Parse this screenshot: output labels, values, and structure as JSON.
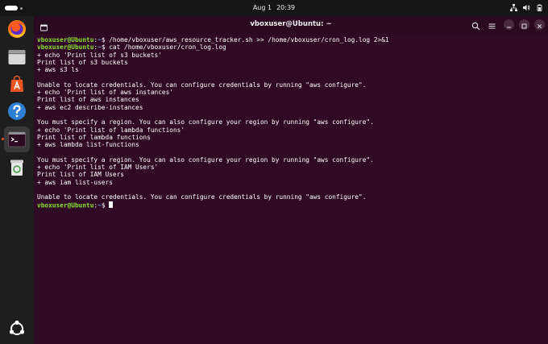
{
  "topbar": {
    "date": "Aug 1",
    "time": "20:39",
    "tray_icons": [
      "network-icon",
      "volume-icon",
      "battery-icon"
    ]
  },
  "dock": {
    "items": [
      {
        "name": "firefox-icon"
      },
      {
        "name": "files-icon"
      },
      {
        "name": "app-center-icon"
      },
      {
        "name": "help-icon"
      },
      {
        "name": "terminal-icon",
        "active": true
      },
      {
        "name": "trash-icon"
      },
      {
        "name": "show-apps-icon"
      }
    ]
  },
  "terminal": {
    "title": "vboxuser@Ubuntu: ~",
    "prompt_user": "vboxuser@Ubuntu",
    "prompt_sep": ":",
    "prompt_path": "~",
    "prompt_sym": "$ ",
    "lines": [
      {
        "type": "prompt",
        "text": "/home/vboxuser/aws_resource_tracker.sh >> /home/vboxuser/cron_log.log 2>&1"
      },
      {
        "type": "prompt",
        "text": "cat /home/vboxuser/cron_log.log"
      },
      {
        "type": "out",
        "text": "+ echo 'Print list of s3 buckets'"
      },
      {
        "type": "out",
        "text": "Print list of s3 buckets"
      },
      {
        "type": "out",
        "text": "+ aws s3 ls"
      },
      {
        "type": "out",
        "text": ""
      },
      {
        "type": "out",
        "text": "Unable to locate credentials. You can configure credentials by running \"aws configure\"."
      },
      {
        "type": "out",
        "text": "+ echo 'Print list of aws instances'"
      },
      {
        "type": "out",
        "text": "Print list of aws instances"
      },
      {
        "type": "out",
        "text": "+ aws ec2 describe-instances"
      },
      {
        "type": "out",
        "text": ""
      },
      {
        "type": "out",
        "text": "You must specify a region. You can also configure your region by running \"aws configure\"."
      },
      {
        "type": "out",
        "text": "+ echo 'Print list of lambda functions'"
      },
      {
        "type": "out",
        "text": "Print list of lambda functions"
      },
      {
        "type": "out",
        "text": "+ aws lambda list-functions"
      },
      {
        "type": "out",
        "text": ""
      },
      {
        "type": "out",
        "text": "You must specify a region. You can also configure your region by running \"aws configure\"."
      },
      {
        "type": "out",
        "text": "+ echo 'Print list of IAM Users'"
      },
      {
        "type": "out",
        "text": "Print list of IAM Users"
      },
      {
        "type": "out",
        "text": "+ aws iam list-users"
      },
      {
        "type": "out",
        "text": ""
      },
      {
        "type": "out",
        "text": "Unable to locate credentials. You can configure credentials by running \"aws configure\"."
      },
      {
        "type": "prompt",
        "text": "",
        "cursor": true
      }
    ]
  }
}
